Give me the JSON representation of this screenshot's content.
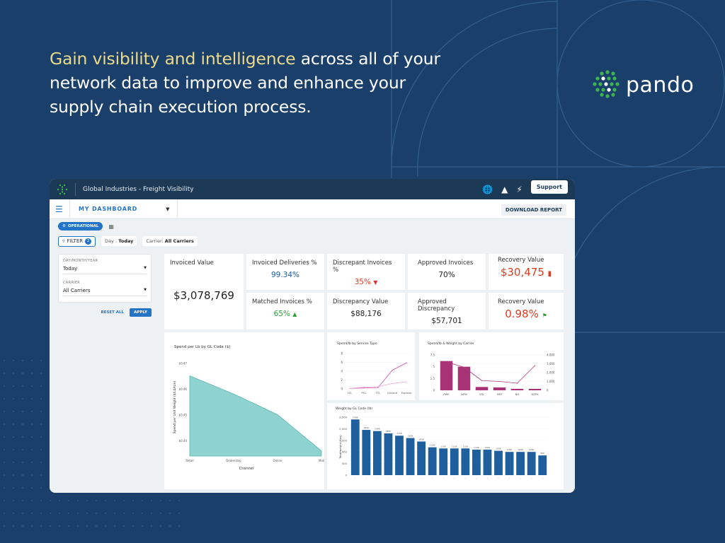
{
  "colors": {
    "bg": "#1b3f6b",
    "highlight": "#e9d98a",
    "accent": "#2374c7",
    "teal": "#8fd3d0",
    "magenta": "#a83276",
    "bar_blue": "#1f5f9e"
  },
  "headline": {
    "highlight": "Gain visibility and intelligence",
    "rest": " across all of your network data to improve and enhance your supply chain execution process."
  },
  "logo": {
    "text": "pando"
  },
  "app": {
    "title": "Global Industries - Freight Visibility",
    "support_label": "Support",
    "dashboard_label": "MY DASHBOARD",
    "download_label": "DOWNLOAD REPORT",
    "operational_label": "OPERATIONAL",
    "filter": {
      "label": "FILTER",
      "count": "2",
      "chip_day_label": "Day :",
      "chip_day_value": "Today",
      "chip_carrier_label": "Carrier:",
      "chip_carrier_value": "All Carriers"
    },
    "sidebar": {
      "date_label": "DAY/MONTH/YEAR",
      "date_value": "Today",
      "carrier_label": "CARRIER",
      "carrier_value": "All Carriers",
      "reset_label": "RESET ALL",
      "apply_label": "APPLY"
    }
  },
  "kpis": {
    "invoiced_value": {
      "label": "Invoiced Value",
      "value": "$3,078,769"
    },
    "invoiced_deliveries": {
      "label": "Invoiced Deliveries %",
      "value": "99.34%"
    },
    "discrepant_invoices": {
      "label": "Discrepant Invoices %",
      "value": "35%"
    },
    "approved_invoices": {
      "label": "Approved Invoices",
      "value": "70%"
    },
    "recovery_value": {
      "label": "Recovery Value",
      "value": "$30,475"
    },
    "matched_invoices": {
      "label": "Matched Invoices %",
      "value": "65%"
    },
    "discrepancy_value": {
      "label": "Discrepancy Value",
      "value": "$88,176"
    },
    "approved_discrepancy": {
      "label": "Approved Discrepancy",
      "value": "$57,701"
    },
    "recovery_value_pct": {
      "label": "Recovery Value",
      "value": "0.98%"
    }
  },
  "chart_data": [
    {
      "type": "area",
      "title": "Spend per Lb by GL Code ($)",
      "xlabel": "Channel",
      "ylabel": "Spend per Unit Weight ($/Lb/ton)",
      "categories": [
        "Retail",
        "Dealership",
        "Online",
        "Mail"
      ],
      "values": [
        0.465,
        0.458,
        0.45,
        0.436
      ],
      "ylim": [
        0.434,
        0.472
      ],
      "yticks": [
        "$0.47",
        "$0.46",
        "$0.45",
        "$0.44"
      ]
    },
    {
      "type": "line",
      "title": "Spend/lb by Service Type",
      "categories": [
        "LTL",
        "PCL",
        "FTL",
        "Ground",
        "Express"
      ],
      "series": [
        {
          "name": "",
          "values": [
            0.1,
            0.2,
            0.3,
            4.2,
            5.9
          ]
        },
        {
          "name": "",
          "values": [
            0.1,
            0.4,
            0.5,
            1.2,
            1.6
          ]
        }
      ],
      "ylim": [
        0,
        8
      ],
      "yticks": [
        "8",
        "6",
        "4",
        "2",
        "0"
      ]
    },
    {
      "type": "bar",
      "title": "Spend/lb & Weight by Carrier",
      "categories": [
        "PWE",
        "NPW",
        "VSL",
        "HBT",
        "BH",
        "DZPA"
      ],
      "bars": [
        6.2,
        5,
        0.7,
        0.6,
        0.3,
        0.3
      ],
      "line": [
        3200,
        2600,
        1100,
        1000,
        800,
        2800
      ],
      "ylim": [
        0,
        7.5
      ],
      "y2lim": [
        0,
        4000
      ],
      "yticks": [
        "7.5",
        "5",
        "2.5",
        "0"
      ],
      "y2ticks": [
        "4,000",
        "3,000",
        "2,000",
        "1,000",
        "0"
      ]
    },
    {
      "type": "bar",
      "title": "Weight by GL Code (lb)",
      "ylabel": "Total weight (Lbs)",
      "values": [
        2400,
        1950,
        1900,
        1800,
        1700,
        1600,
        1450,
        1200,
        1150,
        1150,
        1150,
        1100,
        1100,
        1050,
        1000,
        1000,
        1000,
        850
      ],
      "labels": [
        "240K",
        "195K",
        "190K",
        "180K",
        "170K",
        "160K",
        "145K",
        "120K",
        "115K",
        "115K",
        "115K",
        "110K",
        "110K",
        "105K",
        "100K",
        "100K",
        "100K",
        "85K"
      ],
      "ylim": [
        0,
        2500
      ],
      "yticks": [
        "2,500",
        "2,000",
        "1,500",
        "1,000",
        "500",
        "0"
      ]
    }
  ]
}
